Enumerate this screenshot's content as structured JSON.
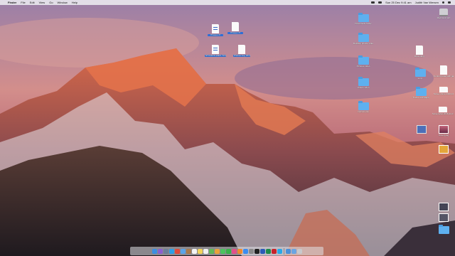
{
  "menubar": {
    "apple": "",
    "app": "Finder",
    "menus": [
      "File",
      "Edit",
      "View",
      "Go",
      "Window",
      "Help"
    ],
    "clock": "Sun 25 Dec  9:41 am",
    "user": "Judith Van Wersen"
  },
  "desktop_icons": [
    {
      "id": "drive",
      "kind": "drive",
      "label": "Macintosh HD",
      "selected": false
    },
    {
      "id": "doc-a",
      "kind": "doc",
      "label": "Phases.rtf",
      "selected": true
    },
    {
      "id": "doc-b",
      "kind": "doc",
      "label": "Phases.rtf",
      "selected": true
    },
    {
      "id": "doc-c",
      "kind": "doc",
      "label": "STUARTS WELL SCREENING.rtfd",
      "selected": true
    },
    {
      "id": "doc-d",
      "kind": "doc",
      "label": "Phases Aug 2016",
      "selected": true
    },
    {
      "id": "f-1",
      "kind": "folder",
      "label": "Downloads folder",
      "selected": false
    },
    {
      "id": "f-2",
      "kind": "folder",
      "label": "Desktop photos video",
      "selected": false
    },
    {
      "id": "f-3",
      "kind": "folder",
      "label": "Pictures video",
      "selected": false
    },
    {
      "id": "f-4",
      "kind": "folder",
      "label": "Videos video",
      "selected": false
    },
    {
      "id": "f-5",
      "kind": "folder",
      "label": "Instruments",
      "selected": false
    },
    {
      "id": "doc-e",
      "kind": "doc",
      "label": "Drive.dmg",
      "selected": false
    },
    {
      "id": "f-6",
      "kind": "folder",
      "label": "temp",
      "selected": false
    },
    {
      "id": "doc-f",
      "kind": "doc",
      "label": "Control panel with gate.png",
      "selected": false
    },
    {
      "id": "f-7",
      "kind": "folder",
      "label": "Tracks and Maps",
      "selected": false
    },
    {
      "id": "doc-g",
      "kind": "doc",
      "label": "Screen Shot 2016-10 ... am.png",
      "selected": false
    },
    {
      "id": "doc-h",
      "kind": "doc",
      "label": "Screenshot 2016-12-15 11.21.png",
      "selected": false
    },
    {
      "id": "stack",
      "kind": "stack",
      "label": "",
      "selected": false
    },
    {
      "id": "img-a",
      "kind": "img",
      "label": "Cover.jpeg",
      "selected": false
    },
    {
      "id": "img-b",
      "kind": "img",
      "label": "",
      "selected": false
    },
    {
      "id": "img-c",
      "kind": "img",
      "label": "",
      "selected": false
    },
    {
      "id": "img-d",
      "kind": "img",
      "label": "",
      "selected": false
    },
    {
      "id": "f-8",
      "kind": "folder",
      "label": "",
      "selected": false
    }
  ],
  "dock": [
    {
      "name": "finder",
      "color": "#3d8ee0",
      "glyph": ""
    },
    {
      "name": "siri",
      "color": "#8b5fcf",
      "glyph": ""
    },
    {
      "name": "launchpad",
      "color": "#6b7f99",
      "glyph": ""
    },
    {
      "name": "safari",
      "color": "#2d9fe6",
      "glyph": ""
    },
    {
      "name": "chrome",
      "color": "#e2493a",
      "glyph": ""
    },
    {
      "name": "mail",
      "color": "#5aa4e8",
      "glyph": ""
    },
    {
      "name": "contacts",
      "color": "#a97a4a",
      "glyph": ""
    },
    {
      "name": "calendar",
      "color": "#f4f4f4",
      "glyph": ""
    },
    {
      "name": "notes",
      "color": "#f2d35a",
      "glyph": ""
    },
    {
      "name": "reminders",
      "color": "#f0f0f0",
      "glyph": ""
    },
    {
      "name": "maps",
      "color": "#62b85a",
      "glyph": ""
    },
    {
      "name": "photos",
      "color": "#e8a23c",
      "glyph": ""
    },
    {
      "name": "messages",
      "color": "#4cc35e",
      "glyph": ""
    },
    {
      "name": "facetime",
      "color": "#3ab24a",
      "glyph": ""
    },
    {
      "name": "itunes",
      "color": "#e2508a",
      "glyph": ""
    },
    {
      "name": "ibooks",
      "color": "#f08a2e",
      "glyph": ""
    },
    {
      "name": "app-store",
      "color": "#3b8cf0",
      "glyph": ""
    },
    {
      "name": "preferences",
      "color": "#8a8a8a",
      "glyph": ""
    },
    {
      "name": "terminal",
      "color": "#222222",
      "glyph": ""
    },
    {
      "name": "word",
      "color": "#2b5bb8",
      "glyph": ""
    },
    {
      "name": "excel",
      "color": "#1f8a4c",
      "glyph": ""
    },
    {
      "name": "acrobat",
      "color": "#c8232c",
      "glyph": ""
    },
    {
      "name": "skype",
      "color": "#29a8e8",
      "glyph": ""
    },
    {
      "name": "sep",
      "color": "",
      "glyph": ""
    },
    {
      "name": "downloads",
      "color": "#4a90d9",
      "glyph": ""
    },
    {
      "name": "documents",
      "color": "#6aa5e2",
      "glyph": ""
    },
    {
      "name": "trash",
      "color": "#c7c9cc",
      "glyph": ""
    }
  ]
}
